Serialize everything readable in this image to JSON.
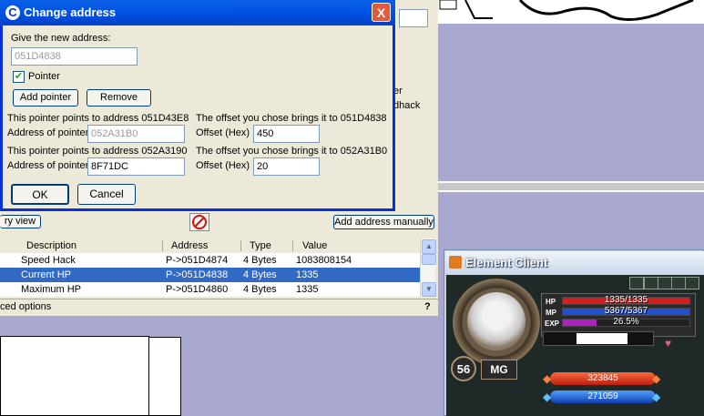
{
  "dialog": {
    "title": "Change address",
    "close_glyph": "X",
    "new_address_label": "Give the new address:",
    "new_address_value": "051D4838",
    "pointer_label": "Pointer",
    "pointer_checked": true,
    "add_pointer": "Add pointer",
    "remove": "Remove",
    "pointer1": {
      "points_to": "This pointer points to address 051D43E8",
      "offset_brings": "The offset you chose brings it to 051D4838",
      "address_label": "Address of pointer",
      "address_value": "052A31B0",
      "offset_label": "Offset (Hex)",
      "offset_value": "450"
    },
    "pointer2": {
      "points_to": "This pointer points to address 052A3190",
      "offset_brings": "The offset you chose brings it to 052A31B0",
      "address_label": "Address of pointer",
      "address_value": "8F71DC",
      "offset_label": "Offset (Hex)",
      "offset_value": "20"
    },
    "ok": "OK",
    "cancel": "Cancel"
  },
  "main": {
    "side_text_1": "er",
    "side_text_2": "dhack",
    "memory_view": "ry view",
    "add_address_manually": "Add address manually",
    "columns": [
      "Description",
      "Address",
      "Type",
      "Value"
    ],
    "rows": [
      {
        "description": "Speed Hack",
        "address": "P->051D4874",
        "type": "4 Bytes",
        "value": "1083808154"
      },
      {
        "description": "Current HP",
        "address": "P->051D4838",
        "type": "4 Bytes",
        "value": "1335"
      },
      {
        "description": "Maximum HP",
        "address": "P->051D4860",
        "type": "4 Bytes",
        "value": "1335"
      }
    ],
    "advanced_options": "ced options",
    "help": "?"
  },
  "game": {
    "title": "Element Client",
    "hp_label": "HP",
    "hp_value": "1335/1335",
    "mp_label": "MP",
    "mp_value": "5367/5367",
    "exp_label": "EXP",
    "exp_value": "26.5%",
    "exp_fraction": 0.265,
    "level": "56",
    "class": "MG",
    "stat1": "323845",
    "stat2": "271059"
  },
  "colors": {
    "titlebar": "#0055e5",
    "selection": "#316ac5",
    "hp_bar": "#d02020",
    "mp_bar": "#2050d0",
    "exp_bar": "#b020c0"
  },
  "icons": [
    "cheat-engine-icon",
    "close-icon",
    "checkmark-icon",
    "stop-icon",
    "scroll-up-icon",
    "scroll-down-icon",
    "element-client-icon"
  ]
}
